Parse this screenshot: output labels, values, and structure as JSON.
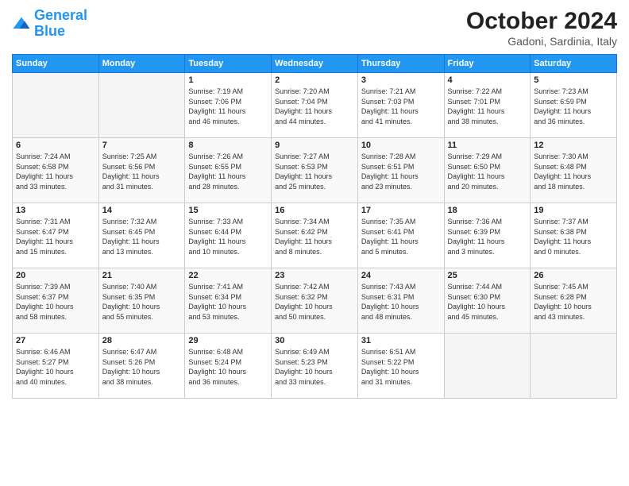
{
  "header": {
    "logo_line1": "General",
    "logo_line2": "Blue",
    "month_year": "October 2024",
    "location": "Gadoni, Sardinia, Italy"
  },
  "weekdays": [
    "Sunday",
    "Monday",
    "Tuesday",
    "Wednesday",
    "Thursday",
    "Friday",
    "Saturday"
  ],
  "weeks": [
    [
      {
        "day": "",
        "info": ""
      },
      {
        "day": "",
        "info": ""
      },
      {
        "day": "1",
        "info": "Sunrise: 7:19 AM\nSunset: 7:06 PM\nDaylight: 11 hours\nand 46 minutes."
      },
      {
        "day": "2",
        "info": "Sunrise: 7:20 AM\nSunset: 7:04 PM\nDaylight: 11 hours\nand 44 minutes."
      },
      {
        "day": "3",
        "info": "Sunrise: 7:21 AM\nSunset: 7:03 PM\nDaylight: 11 hours\nand 41 minutes."
      },
      {
        "day": "4",
        "info": "Sunrise: 7:22 AM\nSunset: 7:01 PM\nDaylight: 11 hours\nand 38 minutes."
      },
      {
        "day": "5",
        "info": "Sunrise: 7:23 AM\nSunset: 6:59 PM\nDaylight: 11 hours\nand 36 minutes."
      }
    ],
    [
      {
        "day": "6",
        "info": "Sunrise: 7:24 AM\nSunset: 6:58 PM\nDaylight: 11 hours\nand 33 minutes."
      },
      {
        "day": "7",
        "info": "Sunrise: 7:25 AM\nSunset: 6:56 PM\nDaylight: 11 hours\nand 31 minutes."
      },
      {
        "day": "8",
        "info": "Sunrise: 7:26 AM\nSunset: 6:55 PM\nDaylight: 11 hours\nand 28 minutes."
      },
      {
        "day": "9",
        "info": "Sunrise: 7:27 AM\nSunset: 6:53 PM\nDaylight: 11 hours\nand 25 minutes."
      },
      {
        "day": "10",
        "info": "Sunrise: 7:28 AM\nSunset: 6:51 PM\nDaylight: 11 hours\nand 23 minutes."
      },
      {
        "day": "11",
        "info": "Sunrise: 7:29 AM\nSunset: 6:50 PM\nDaylight: 11 hours\nand 20 minutes."
      },
      {
        "day": "12",
        "info": "Sunrise: 7:30 AM\nSunset: 6:48 PM\nDaylight: 11 hours\nand 18 minutes."
      }
    ],
    [
      {
        "day": "13",
        "info": "Sunrise: 7:31 AM\nSunset: 6:47 PM\nDaylight: 11 hours\nand 15 minutes."
      },
      {
        "day": "14",
        "info": "Sunrise: 7:32 AM\nSunset: 6:45 PM\nDaylight: 11 hours\nand 13 minutes."
      },
      {
        "day": "15",
        "info": "Sunrise: 7:33 AM\nSunset: 6:44 PM\nDaylight: 11 hours\nand 10 minutes."
      },
      {
        "day": "16",
        "info": "Sunrise: 7:34 AM\nSunset: 6:42 PM\nDaylight: 11 hours\nand 8 minutes."
      },
      {
        "day": "17",
        "info": "Sunrise: 7:35 AM\nSunset: 6:41 PM\nDaylight: 11 hours\nand 5 minutes."
      },
      {
        "day": "18",
        "info": "Sunrise: 7:36 AM\nSunset: 6:39 PM\nDaylight: 11 hours\nand 3 minutes."
      },
      {
        "day": "19",
        "info": "Sunrise: 7:37 AM\nSunset: 6:38 PM\nDaylight: 11 hours\nand 0 minutes."
      }
    ],
    [
      {
        "day": "20",
        "info": "Sunrise: 7:39 AM\nSunset: 6:37 PM\nDaylight: 10 hours\nand 58 minutes."
      },
      {
        "day": "21",
        "info": "Sunrise: 7:40 AM\nSunset: 6:35 PM\nDaylight: 10 hours\nand 55 minutes."
      },
      {
        "day": "22",
        "info": "Sunrise: 7:41 AM\nSunset: 6:34 PM\nDaylight: 10 hours\nand 53 minutes."
      },
      {
        "day": "23",
        "info": "Sunrise: 7:42 AM\nSunset: 6:32 PM\nDaylight: 10 hours\nand 50 minutes."
      },
      {
        "day": "24",
        "info": "Sunrise: 7:43 AM\nSunset: 6:31 PM\nDaylight: 10 hours\nand 48 minutes."
      },
      {
        "day": "25",
        "info": "Sunrise: 7:44 AM\nSunset: 6:30 PM\nDaylight: 10 hours\nand 45 minutes."
      },
      {
        "day": "26",
        "info": "Sunrise: 7:45 AM\nSunset: 6:28 PM\nDaylight: 10 hours\nand 43 minutes."
      }
    ],
    [
      {
        "day": "27",
        "info": "Sunrise: 6:46 AM\nSunset: 5:27 PM\nDaylight: 10 hours\nand 40 minutes."
      },
      {
        "day": "28",
        "info": "Sunrise: 6:47 AM\nSunset: 5:26 PM\nDaylight: 10 hours\nand 38 minutes."
      },
      {
        "day": "29",
        "info": "Sunrise: 6:48 AM\nSunset: 5:24 PM\nDaylight: 10 hours\nand 36 minutes."
      },
      {
        "day": "30",
        "info": "Sunrise: 6:49 AM\nSunset: 5:23 PM\nDaylight: 10 hours\nand 33 minutes."
      },
      {
        "day": "31",
        "info": "Sunrise: 6:51 AM\nSunset: 5:22 PM\nDaylight: 10 hours\nand 31 minutes."
      },
      {
        "day": "",
        "info": ""
      },
      {
        "day": "",
        "info": ""
      }
    ]
  ]
}
